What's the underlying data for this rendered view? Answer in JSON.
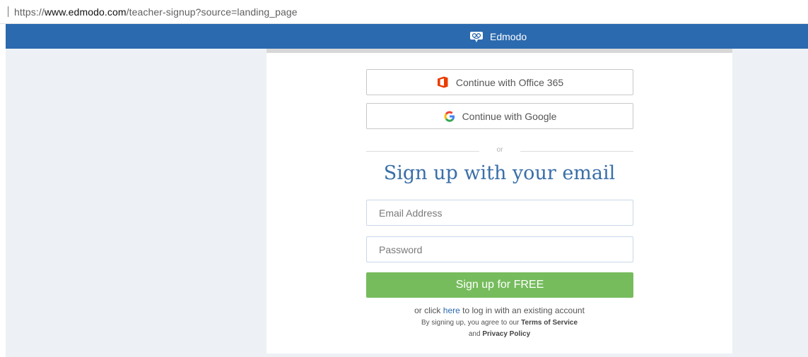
{
  "browser": {
    "url_scheme": "https://",
    "url_host": "www.edmodo.com",
    "url_path": "/teacher-signup?source=landing_page"
  },
  "header": {
    "brand_name": "Edmodo",
    "logo_icon": "edmodo-logo-icon",
    "background_color": "#2b6aaf"
  },
  "signup": {
    "office_button_label": "Continue with Office 365",
    "office_icon": "office-365-icon",
    "google_button_label": "Continue with Google",
    "google_icon": "google-icon",
    "divider_text": "or",
    "title": "Sign up with your email",
    "email_placeholder": "Email Address",
    "password_placeholder": "Password",
    "submit_label": "Sign up for FREE",
    "submit_color": "#76bc5d",
    "login_prefix": "or click ",
    "login_link": "here",
    "login_suffix": " to log in with an existing account",
    "terms_prefix": "By signing up, you agree to our ",
    "terms_link": "Terms of Service",
    "terms_and": "and ",
    "privacy_link": "Privacy Policy"
  }
}
